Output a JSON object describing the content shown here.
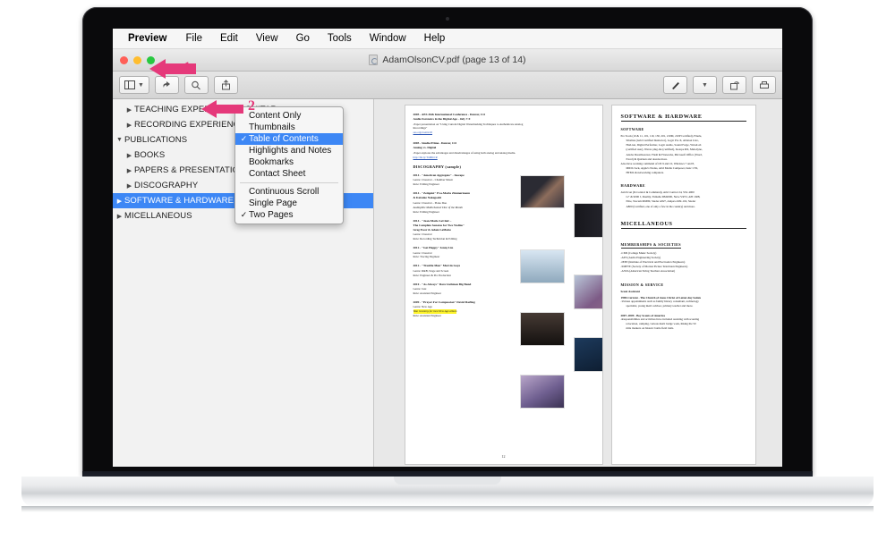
{
  "window": {
    "doc_title": "AdamOlsonCV.pdf (page 13 of 14)",
    "doc_icon": "pdf-document-icon"
  },
  "menubar": {
    "app": "Preview",
    "items": [
      "File",
      "Edit",
      "View",
      "Go",
      "Tools",
      "Window",
      "Help"
    ]
  },
  "toolbar": {
    "sidebar_button": "sidebar-view-button",
    "back_button": "back-arrow-icon",
    "zoom_button": "zoom-icon",
    "share_button": "share-icon",
    "markup_button": "markup-pen-icon",
    "rotate_button": "rotate-icon",
    "print_button": "print-icon"
  },
  "view_menu": {
    "groups": [
      [
        {
          "label": "Content Only",
          "checked": false
        },
        {
          "label": "Thumbnails",
          "checked": false
        },
        {
          "label": "Table of Contents",
          "checked": true,
          "selected": true
        },
        {
          "label": "Highlights and Notes",
          "checked": false
        },
        {
          "label": "Bookmarks",
          "checked": false
        },
        {
          "label": "Contact Sheet",
          "checked": false
        }
      ],
      [
        {
          "label": "Continuous Scroll",
          "checked": false
        },
        {
          "label": "Single Page",
          "checked": false
        },
        {
          "label": "Two Pages",
          "checked": true
        }
      ]
    ]
  },
  "sidebar": {
    "items": [
      {
        "label": "TEACHING EXPERIENCE - GUITAR",
        "level": 2,
        "expanded": false,
        "selected": false
      },
      {
        "label": "RECORDING EXPERIENCE – AUDIO ENGINEER",
        "level": 2,
        "expanded": false,
        "selected": false
      },
      {
        "label": "PUBLICATIONS",
        "level": 1,
        "expanded": true,
        "selected": false
      },
      {
        "label": "BOOKS",
        "level": 2,
        "expanded": false,
        "selected": false
      },
      {
        "label": "PAPERS & PRESENTATIONS",
        "level": 2,
        "expanded": false,
        "selected": false
      },
      {
        "label": "DISCOGRAPHY",
        "level": 2,
        "expanded": false,
        "selected": false
      },
      {
        "label": "SOFTWARE & HARDWARE SKILLS",
        "level": 1,
        "expanded": false,
        "selected": true
      },
      {
        "label": "MICELLANEOUS",
        "level": 1,
        "expanded": false,
        "selected": false
      }
    ]
  },
  "annotations": [
    {
      "id": "1",
      "label": "1",
      "color": "#e5397a"
    },
    {
      "id": "2",
      "label": "2",
      "color": "#e5397a"
    }
  ],
  "left_page": {
    "page_number": "12",
    "entries": [
      {
        "hd": "2005 - AES 26th International Conference - Denver, CO",
        "sub": "Audio Forensics in the Digital Age - July 7-9",
        "lines": [
          "-Paper presentation on \"Using Current Digital Watermarking Techniques to Authenticate Analog",
          "   Recordings\""
        ],
        "link": "aes.org/events/26"
      },
      {
        "hd": "2005 - Studio Prime - Denver, CO",
        "sub": "Analog vs. Digital",
        "lines": [
          "-Paper explores the advantages and disadvantages of using both analog and analog media."
        ],
        "link": "http://bit.ly/TxMKCR"
      }
    ],
    "section_heading": "DISCOGRAPHY (sample)",
    "discography": [
      {
        "title": "2014 - \"American Aggregate\" - Inscape",
        "lines": [
          "Genre: Classical – Chamber Music",
          "Role: Editing Engineer"
        ]
      },
      {
        "title": "2014 - \"Zeitgeist\" Eva-Maria Zimmermann",
        "title2": "& Keisuke Nakagoshi",
        "lines": [
          "Genre: Classical – Piano Duo",
          "Audiophile Multichannel Disc of the Month",
          "Role: Editing Engineer"
        ]
      },
      {
        "title": "2014 - \"Jean-Marie LeClair –",
        "title2": "The Complete Sonatas for Two Violins\"",
        "title3": "Greg Ewer & Adam LaMotte",
        "lines": [
          "Genre: Classical",
          "Role: Recording Technician & Editing"
        ]
      },
      {
        "title": "2012 - \"Get Happy\" Jenny Lin",
        "lines": [
          "Genre: Classical",
          "Role: Tracing Engineer"
        ]
      },
      {
        "title": "2012 - \"Trouble Man\" Marvin Gaye",
        "lines": [
          "Genre: R&B, Stage and Screen",
          " Role: Engineer & Pre Production"
        ]
      },
      {
        "title": "2010 - \"As Always\" Dave Liebman Big Band",
        "lines": [
          "Genre: Jazz",
          "Role: Assistant Engineer"
        ]
      },
      {
        "title": "2009 - \"Prayer For Compassion\" David Darling",
        "lines": [
          "Genre: New Age"
        ],
        "highlight": "Won Grammy for best New Age album",
        "after": "Role: Assistant Engineer"
      }
    ]
  },
  "right_page": {
    "heading": "SOFTWARE & HARDWARE",
    "sections": [
      {
        "title": "SOFTWARE",
        "lines": [
          "Pro Tools (10 & 11, 101, 110, 130, 201, 210M, 210P Certified), Finale,",
          "Sibelius (Avid Certified Instructor), Logic Pro X, Ableton Live,",
          "HALion, Digital Performer, Logic Audio, Sound Forge, WaveLab",
          "(certified user), Waves plug-ins (certified), Izotope RX, Melodyne,",
          "Adobe Dreamweaver, Flash & Fireworks, Microsoft Office (Word,",
          "Excel) & Quicken  and dozens more.",
          "Also have working command of OS 9 and 10, Windows 7 and 8,",
          "MIDI clock, Apple's Nodes, Avid Media Composer, basic CSS,",
          "HTML & networking computers."
        ]
      },
      {
        "title": "HARDWARE",
        "lines": [
          "Avid Icon (D-Control & Command), Avid Control 24, SSL 4000",
          "G+ & 9000 J, Duality, Yamaha DM2000, Neve VR72, API 1608,",
          "Elite, Tascam MM80, Studer A827, Ampex ATR-102, Studer",
          "A800 (Certified, one of only a few in the country) and more."
        ]
      }
    ],
    "misc_heading": "MICELLANEOUS",
    "memberships_title": "MEMBERSHIPS & SOCIETIES",
    "memberships": [
      "-CMS (College Music Society)",
      "-AES (Audio Engineering Society)",
      "-IEEE (Institute of Electrical and Electronics Engineers)",
      "-SMPTE (Society of Motion Picture Television Engineers)",
      "-ASTA (American String Teachers Association)"
    ],
    "mission_title": "MISSION & SERVICE",
    "mission": [
      {
        "bold": "Scout Assistant"
      },
      {
        "bold": "1998-Current - The Church of Jesus Christ of Latter-day Saints",
        "lines": [
          "-Various appointments such as family history consultant, technology",
          "   specialist, young men's advisor, primary teacher and more."
        ]
      },
      {
        "bold": "2007–2009 - Boy Scouts of America",
        "lines": [
          "-Responsibilities and activities have included assisting with scouting",
          "   relocation, camping, various merit badge work, hiking the 50",
          "   mile markers on historic battle field trails."
        ]
      }
    ]
  }
}
